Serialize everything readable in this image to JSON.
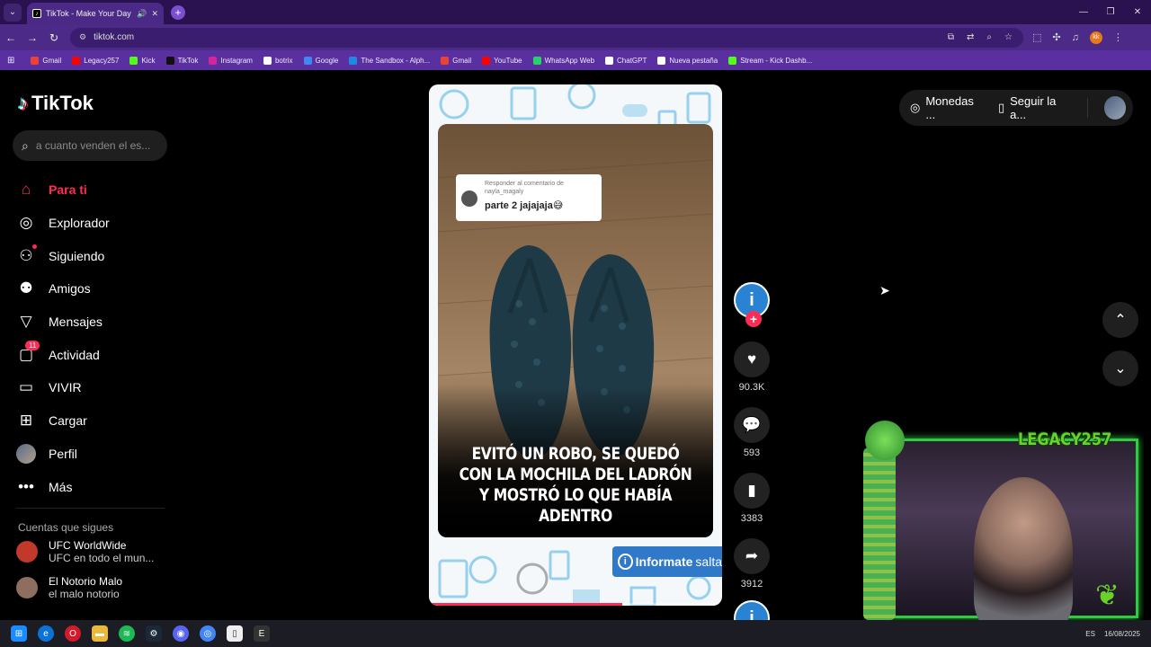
{
  "browser": {
    "tab_title": "TikTok - Make Your Day",
    "url": "tiktok.com",
    "bookmarks": [
      {
        "label": "Gmail",
        "color": "#ea4335"
      },
      {
        "label": "Legacy257",
        "color": "#ff0000"
      },
      {
        "label": "Kick",
        "color": "#53fc18"
      },
      {
        "label": "TikTok",
        "color": "#111111"
      },
      {
        "label": "Instagram",
        "color": "#d6249f"
      },
      {
        "label": "botrix",
        "color": "#ffffff"
      },
      {
        "label": "Google",
        "color": "#4285f4"
      },
      {
        "label": "The Sandbox - Alph...",
        "color": "#1e88e5"
      },
      {
        "label": "Gmail",
        "color": "#ea4335"
      },
      {
        "label": "YouTube",
        "color": "#ff0000"
      },
      {
        "label": "WhatsApp Web",
        "color": "#25d366"
      },
      {
        "label": "ChatGPT",
        "color": "#ffffff"
      },
      {
        "label": "Nueva pestaña",
        "color": "#ffffff"
      },
      {
        "label": "Stream - Kick Dashb...",
        "color": "#53fc18"
      }
    ]
  },
  "sidebar": {
    "logo": "TikTok",
    "search_placeholder": "a cuanto venden el es...",
    "menu": [
      {
        "label": "Para ti",
        "icon": "home-icon",
        "glyph": "⌂",
        "active": true
      },
      {
        "label": "Explorador",
        "icon": "compass-icon",
        "glyph": "◎"
      },
      {
        "label": "Siguiendo",
        "icon": "following-icon",
        "glyph": "⚇"
      },
      {
        "label": "Amigos",
        "icon": "friends-icon",
        "glyph": "⚉"
      },
      {
        "label": "Mensajes",
        "icon": "messages-icon",
        "glyph": "▽"
      },
      {
        "label": "Actividad",
        "icon": "activity-icon",
        "glyph": "▢",
        "badge": "11"
      },
      {
        "label": "VIVIR",
        "icon": "live-icon",
        "glyph": "▭"
      },
      {
        "label": "Cargar",
        "icon": "upload-icon",
        "glyph": "⊞"
      },
      {
        "label": "Perfil",
        "icon": "profile-avatar",
        "glyph": ""
      },
      {
        "label": "Más",
        "icon": "more-icon",
        "glyph": "•••"
      }
    ],
    "following_title": "Cuentas que sigues",
    "following": [
      {
        "name": "UFC WorldWide",
        "sub": "UFC en todo el mun...",
        "color": "#c0392b"
      },
      {
        "name": "El Notorio Malo",
        "sub": "el malo notorio",
        "color": "#8e6e5e"
      }
    ]
  },
  "video": {
    "reply_header": "Responder al comentario de nayla_magaly",
    "reply_text": "parte 2 jajajaja😅",
    "caption_lines": [
      "EVITÓ UN ROBO, SE QUEDÓ",
      "CON LA MOCHILA DEL LADRÓN",
      "Y MOSTRÓ LO QUE HABÍA ADENTRO"
    ],
    "brand_bold": "Informate",
    "brand_light": "salta",
    "progress": 0.66
  },
  "actions": {
    "likes": "90.3K",
    "comments": "593",
    "saves": "3383",
    "shares": "3912"
  },
  "top_right": {
    "coins": "Monedas ...",
    "follow_app": "Seguir la a..."
  },
  "stream": {
    "channel": "LEGACY257"
  },
  "taskbar": {
    "lang": "ES",
    "date": "16/08/2025"
  }
}
